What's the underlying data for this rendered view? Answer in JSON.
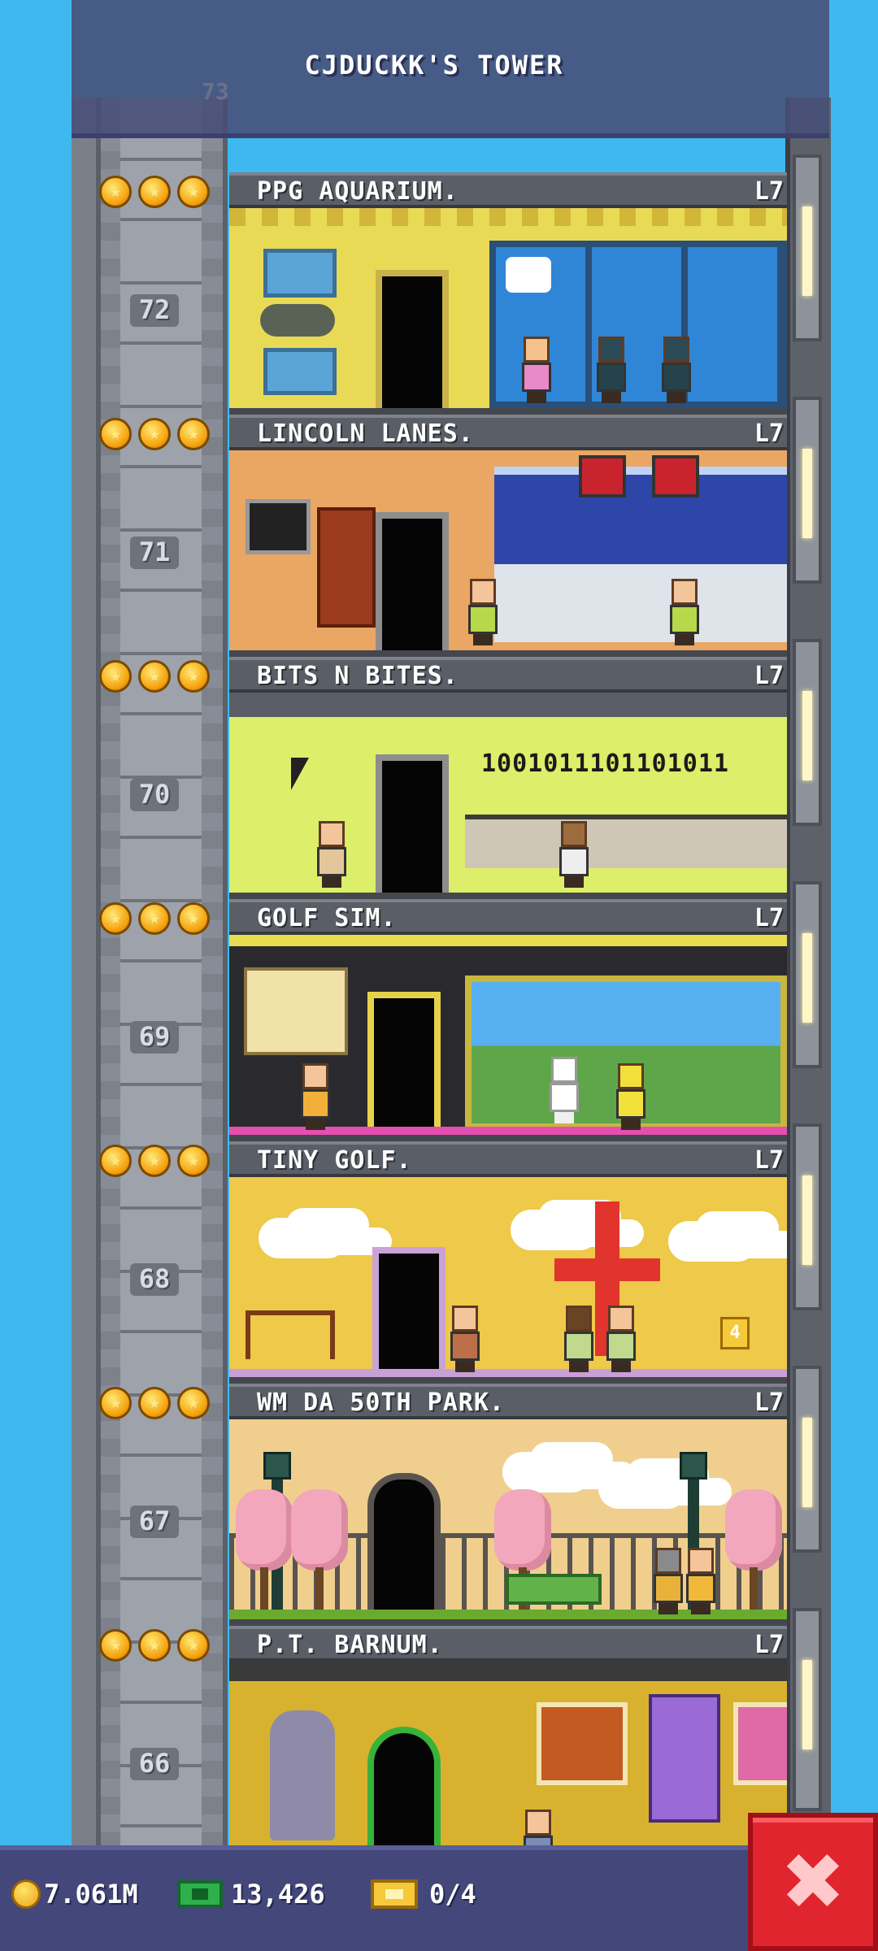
{
  "header": {
    "title": "CJDUCKK'S TOWER",
    "top_floor_number": "73"
  },
  "floors": [
    {
      "number": "72",
      "name": "PPG AQUARIUM.",
      "level": "L7",
      "stars": 3
    },
    {
      "number": "71",
      "name": "LINCOLN LANES.",
      "level": "L7",
      "stars": 3
    },
    {
      "number": "70",
      "name": "BITS N BITES.",
      "level": "L7",
      "stars": 3,
      "sign": "1001011101101011"
    },
    {
      "number": "69",
      "name": "GOLF SIM.",
      "level": "L7",
      "stars": 3
    },
    {
      "number": "68",
      "name": "TINY GOLF.",
      "level": "L7",
      "stars": 3,
      "hole": "4"
    },
    {
      "number": "67",
      "name": "WM DA 50TH PARK.",
      "level": "L7",
      "stars": 3
    },
    {
      "number": "66",
      "name": "P.T. BARNUM.",
      "level": "L7",
      "stars": 3
    }
  ],
  "bottom_bar": {
    "coins": "7.061M",
    "bux": "13,426",
    "tickets": "0/4"
  },
  "close_icon": "close-x-icon",
  "colors": {
    "sky": "#3fb8ef",
    "header": "#484e78",
    "close": "#e0252f",
    "star": "#f5a10e"
  }
}
